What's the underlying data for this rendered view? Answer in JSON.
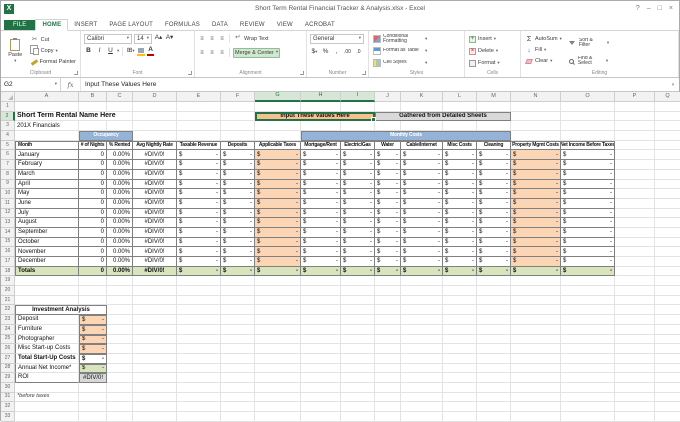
{
  "window": {
    "title": "Short Term Rental Financial Tracker & Analysis.xlsx - Excel",
    "controls": {
      "help": "?",
      "minimize": "–",
      "maximize": "□",
      "close": "×"
    }
  },
  "ribbon": {
    "tabs": [
      "FILE",
      "HOME",
      "INSERT",
      "PAGE LAYOUT",
      "FORMULAS",
      "DATA",
      "REVIEW",
      "VIEW",
      "ACROBAT"
    ],
    "active_tab": "HOME",
    "clipboard": {
      "label": "Clipboard",
      "paste": "Paste",
      "cut": "Cut",
      "copy": "Copy",
      "format_painter": "Format Painter"
    },
    "font": {
      "label": "Font",
      "font_name": "Calibri",
      "font_size": "14",
      "bold": "B",
      "italic": "I",
      "underline": "U"
    },
    "alignment": {
      "label": "Alignment",
      "wrap_text": "Wrap Text",
      "merge_center": "Merge & Center"
    },
    "number": {
      "label": "Number",
      "format": "General",
      "currency": "$",
      "percent": "%",
      "comma": ",",
      "inc_decimal": ".00",
      "dec_decimal": ".0"
    },
    "styles": {
      "label": "Styles",
      "conditional": "Conditional Formatting",
      "format_table": "Format as Table",
      "cell_styles": "Cell Styles"
    },
    "cells": {
      "label": "Cells",
      "insert": "Insert",
      "delete": "Delete",
      "format": "Format"
    },
    "editing": {
      "label": "Editing",
      "autosum_sigma": "Σ",
      "autosum": "AutoSum",
      "fill": "Fill",
      "clear": "Clear",
      "sort_filter": "Sort & Filter",
      "find_select": "Find & Select"
    }
  },
  "formula_bar": {
    "name_box": "G2",
    "fx_label": "fx",
    "content": "Input These Values Here"
  },
  "grid": {
    "column_letters": [
      "A",
      "B",
      "C",
      "D",
      "E",
      "F",
      "G",
      "H",
      "I",
      "J",
      "K",
      "L",
      "M",
      "N",
      "O",
      "P",
      "Q"
    ],
    "row_numbers": [
      1,
      2,
      3,
      4,
      5,
      6,
      7,
      8,
      9,
      10,
      11,
      12,
      13,
      14,
      15,
      16,
      17,
      18,
      19,
      20,
      21,
      22,
      23,
      24,
      25,
      26,
      27,
      28,
      29,
      30,
      31,
      32,
      33
    ]
  },
  "selection": {
    "active_cell": "G2",
    "selected_columns": [
      "G",
      "H",
      "I"
    ],
    "selected_row": 2
  },
  "sheet": {
    "title": "Short Term Rental Name Here",
    "fiscal_year_label": "201X Financials",
    "callouts": {
      "input": "Input These Values Here",
      "gathered": "Gathered from Detailed Sheets"
    },
    "bands": {
      "occupancy": "Occupancy",
      "monthly_costs": "Monthly Costs"
    },
    "table": {
      "headers": [
        "Month",
        "# of Nights",
        "% Rented",
        "Avg Nightly Rate",
        "Taxable Revenue",
        "Deposits",
        "Applicable Taxes",
        "Mortgage/Rent",
        "Electric/Gas",
        "Water",
        "Cable/Internet",
        "Misc Costs",
        "Cleaning",
        "Property Mgmt Costs",
        "Net Income Before Taxes"
      ],
      "months": [
        "January",
        "February",
        "March",
        "April",
        "May",
        "June",
        "July",
        "August",
        "September",
        "October",
        "November",
        "December"
      ],
      "nights_value": "0",
      "pct_value": "0.00%",
      "error_value": "#DIV/0!",
      "money_symbol": "$",
      "money_dash": "-",
      "totals_label": "Totals",
      "totals_nights": "0",
      "totals_pct": "0.00%",
      "totals_error": "#DIV/0!"
    },
    "investment": {
      "title": "Investment Analysis",
      "items": [
        {
          "label": "Deposit",
          "type": "money",
          "fill": "orange"
        },
        {
          "label": "Furniture",
          "type": "money",
          "fill": "orange"
        },
        {
          "label": "Photographer",
          "type": "money",
          "fill": "orange"
        },
        {
          "label": "Misc Start-up Costs",
          "type": "money",
          "fill": "orange"
        },
        {
          "label": "Total Start-Up Costs",
          "type": "money",
          "fill": "none",
          "bold": true,
          "top_border": true
        },
        {
          "label": "Annual Net Income*",
          "type": "money",
          "fill": "green"
        },
        {
          "label": "ROI",
          "type": "error",
          "fill": "gray"
        }
      ]
    },
    "footnote": "*before taxes",
    "colors": {
      "excel_green": "#217346",
      "callout_orange": "#FABF8F",
      "column_orange": "#FCD5B4",
      "callout_gray": "#D9D9D9",
      "band_blue": "#95B3D7",
      "totals_green": "#D8E4BC",
      "investment_green": "#D8E4BC",
      "roi_gray": "#D9D9D9"
    }
  }
}
